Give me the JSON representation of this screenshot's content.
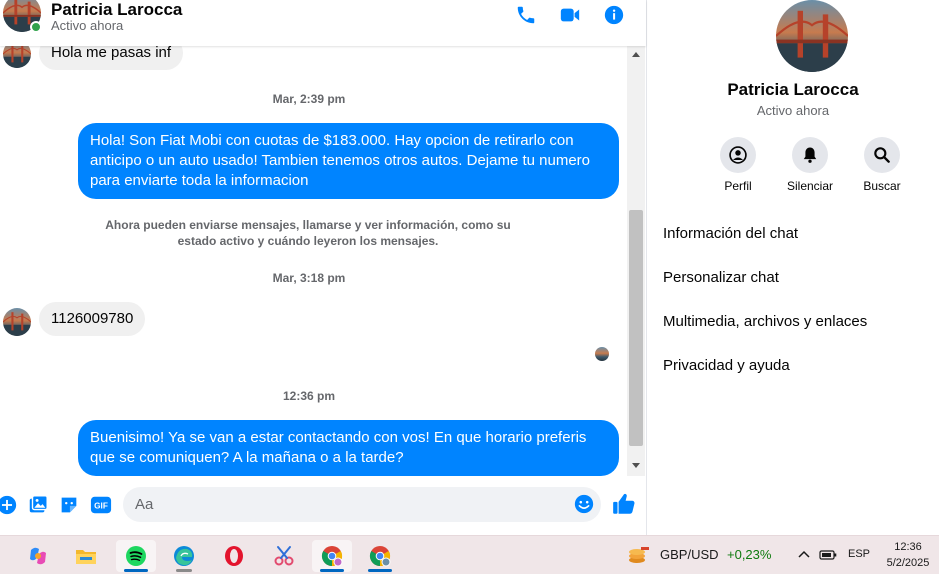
{
  "contact": {
    "name": "Patricia Larocca",
    "status": "Activo ahora"
  },
  "header_icons": [
    "phone-icon",
    "video-camera-icon",
    "info-icon"
  ],
  "messages": {
    "m1": "Hola me pasas inf",
    "ts1": "Mar, 2:39 pm",
    "m2": "Hola! Son Fiat Mobi con cuotas de $183.000. Hay opcion de retirarlo con anticipo o un auto usado! Tambien tenemos otros autos. Dejame tu numero para enviarte toda la informacion",
    "system": "Ahora pueden enviarse mensajes, llamarse y ver información, como su estado activo y cuándo leyeron los mensajes.",
    "ts2": "Mar, 3:18 pm",
    "m3": "1126009780",
    "ts3": "12:36 pm",
    "m4": "Buenisimo! Ya se van a estar contactando con vos! En que horario preferis que se comuniquen? A la mañana o a la tarde?"
  },
  "composer": {
    "placeholder": "Aa",
    "icons": [
      "plus-icon",
      "image-icon",
      "sticker-icon",
      "gif-icon",
      "emoji-icon",
      "like-icon"
    ],
    "gif_label": "GIF"
  },
  "info": {
    "actions": [
      {
        "label": "Perfil",
        "icon": "profile-icon"
      },
      {
        "label": "Silenciar",
        "icon": "bell-icon"
      },
      {
        "label": "Buscar",
        "icon": "search-icon"
      }
    ],
    "items": [
      "Información del chat",
      "Personalizar chat",
      "Multimedia, archivos y enlaces",
      "Privacidad y ayuda"
    ]
  },
  "taskbar": {
    "apps": [
      "copilot-icon",
      "file-explorer-icon",
      "spotify-icon",
      "edge-icon",
      "opera-icon",
      "snipping-tool-icon",
      "chrome-profile-icon",
      "chrome-icon"
    ],
    "ticker_pair": "GBP/USD",
    "ticker_change": "+0,23%",
    "lang": "ESP",
    "time": "12:36",
    "date": "5/2/2025"
  },
  "colors": {
    "accent": "#0084ff",
    "online": "#31a24c",
    "incoming_bubble": "#f0f0f0"
  }
}
